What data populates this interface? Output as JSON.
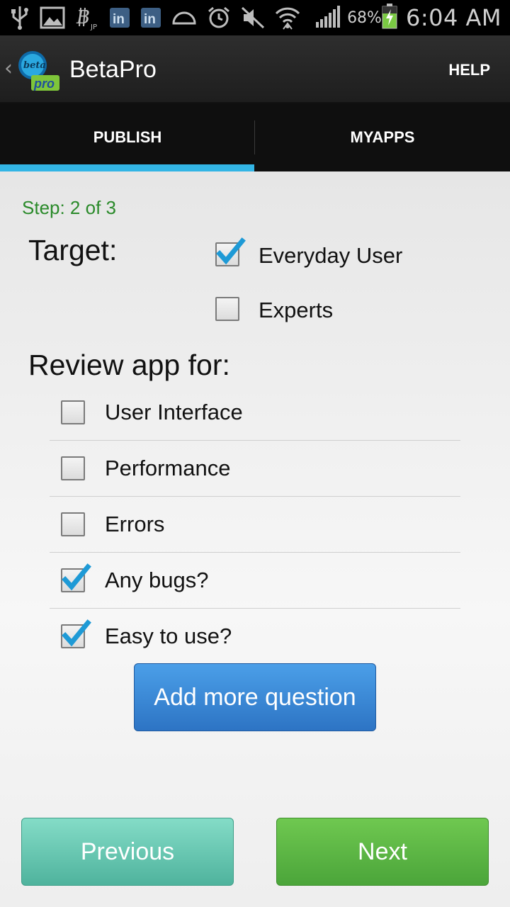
{
  "status_bar": {
    "battery_percent": "68%",
    "time": "6:04 AM",
    "icons": [
      "usb-icon",
      "image-icon",
      "bitcoin-jp-icon",
      "linkedin-icon",
      "linkedin-icon",
      "dome-icon",
      "alarm-icon",
      "mute-icon",
      "wifi-icon",
      "signal-icon",
      "battery-charging-icon"
    ]
  },
  "action_bar": {
    "title": "BetaPro",
    "help_label": "HELP",
    "logo_text_top": "beta",
    "logo_text_bottom": "pro"
  },
  "tabs": [
    {
      "label": "PUBLISH",
      "selected": true
    },
    {
      "label": "MYAPPS",
      "selected": false
    }
  ],
  "form": {
    "step": "Step: 2 of 3",
    "target_heading": "Target:",
    "target_options": [
      {
        "label": "Everyday User",
        "checked": true
      },
      {
        "label": "Experts",
        "checked": false
      }
    ],
    "review_heading": "Review app for:",
    "review_options": [
      {
        "label": "User Interface",
        "checked": false
      },
      {
        "label": "Performance",
        "checked": false
      },
      {
        "label": "Errors",
        "checked": false
      },
      {
        "label": "Any bugs?",
        "checked": true
      },
      {
        "label": "Easy to use?",
        "checked": true
      }
    ],
    "add_question_label": "Add more question",
    "previous_label": "Previous",
    "next_label": "Next"
  },
  "colors": {
    "tab_indicator": "#33b5e5",
    "step_text": "#2a8a2a",
    "add_button": "#2d74c4",
    "previous_button": "#4fb39d",
    "next_button": "#4ba53a",
    "checkmark": "#1e9ad6"
  }
}
